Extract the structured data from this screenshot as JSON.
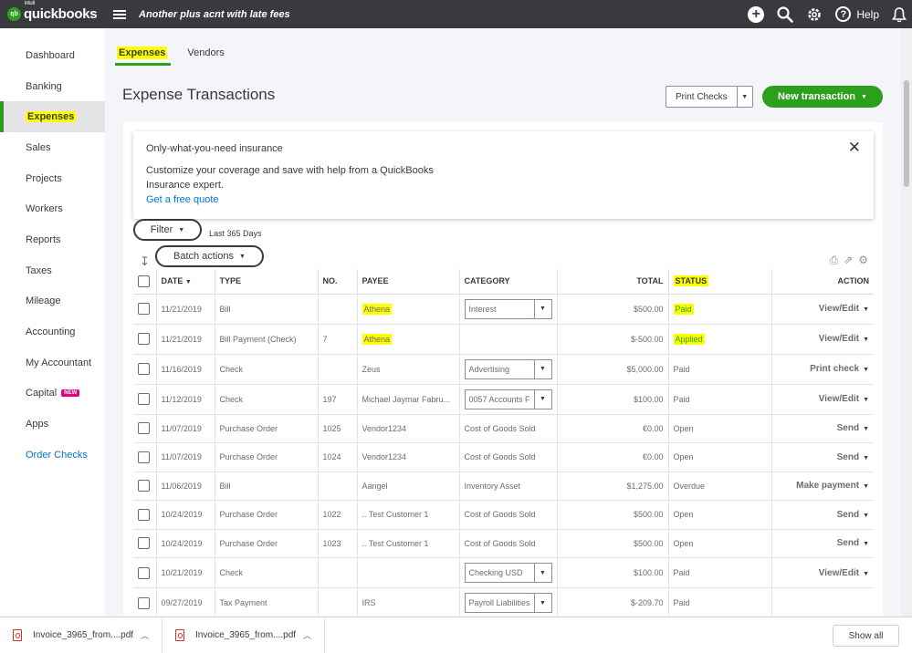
{
  "topbar": {
    "logo_intuit": "intuit",
    "logo_text": "quickbooks",
    "logo_badge": "qb",
    "company_name": "Another plus acnt with late fees",
    "help_label": "Help"
  },
  "sidebar": {
    "items": [
      {
        "label": "Dashboard"
      },
      {
        "label": "Banking"
      },
      {
        "label": "Expenses"
      },
      {
        "label": "Sales"
      },
      {
        "label": "Projects"
      },
      {
        "label": "Workers"
      },
      {
        "label": "Reports"
      },
      {
        "label": "Taxes"
      },
      {
        "label": "Mileage"
      },
      {
        "label": "Accounting"
      },
      {
        "label": "My Accountant"
      },
      {
        "label": "Capital",
        "badge": "NEW"
      },
      {
        "label": "Apps"
      },
      {
        "label": "Order Checks"
      }
    ]
  },
  "tabs": [
    {
      "label": "Expenses"
    },
    {
      "label": "Vendors"
    }
  ],
  "page_title": "Expense Transactions",
  "buttons": {
    "print_checks": "Print Checks",
    "new_transaction": "New transaction",
    "filter": "Filter",
    "filter_range": "Last 365 Days",
    "batch_actions": "Batch actions",
    "show_all": "Show all"
  },
  "insurance": {
    "title": "Only-what-you-need insurance",
    "body": "Customize your coverage and save with help from a QuickBooks Insurance expert.",
    "link": "Get a free quote"
  },
  "table": {
    "headers": {
      "date": "DATE",
      "type": "TYPE",
      "no": "NO.",
      "payee": "PAYEE",
      "category": "CATEGORY",
      "total": "TOTAL",
      "status": "STATUS",
      "action": "ACTION"
    },
    "rows": [
      {
        "date": "11/21/2019",
        "type": "Bill",
        "no": "",
        "payee": "Athena",
        "category": "Interest",
        "total": "$500.00",
        "status": "Paid",
        "action": "View/Edit"
      },
      {
        "date": "11/21/2019",
        "type": "Bill Payment (Check)",
        "no": "7",
        "payee": "Athena",
        "category": "",
        "total": "$-500.00",
        "status": "Applied",
        "action": "View/Edit"
      },
      {
        "date": "11/16/2019",
        "type": "Check",
        "no": "",
        "payee": "Zeus",
        "category": "Advertising",
        "total": "$5,000.00",
        "status": "Paid",
        "action": "Print check"
      },
      {
        "date": "11/12/2019",
        "type": "Check",
        "no": "197",
        "payee": "Michael Jaymar Fabru...",
        "category": "0057 Accounts F",
        "total": "$100.00",
        "status": "Paid",
        "action": "View/Edit"
      },
      {
        "date": "11/07/2019",
        "type": "Purchase Order",
        "no": "1025",
        "payee": "Vendor1234",
        "category": "Cost of Goods Sold",
        "total": "€0.00",
        "status": "Open",
        "action": "Send"
      },
      {
        "date": "11/07/2019",
        "type": "Purchase Order",
        "no": "1024",
        "payee": "Vendor1234",
        "category": "Cost of Goods Sold",
        "total": "€0.00",
        "status": "Open",
        "action": "Send"
      },
      {
        "date": "11/06/2019",
        "type": "Bill",
        "no": "",
        "payee": "Aangel",
        "category": "Inventory Asset",
        "total": "$1,275.00",
        "status": "Overdue",
        "action": "Make payment"
      },
      {
        "date": "10/24/2019",
        "type": "Purchase Order",
        "no": "1022",
        "payee": ".. Test Customer 1",
        "category": "Cost of Goods Sold",
        "total": "$500.00",
        "status": "Open",
        "action": "Send"
      },
      {
        "date": "10/24/2019",
        "type": "Purchase Order",
        "no": "1023",
        "payee": ".. Test Customer 1",
        "category": "Cost of Goods Sold",
        "total": "$500.00",
        "status": "Open",
        "action": "Send"
      },
      {
        "date": "10/21/2019",
        "type": "Check",
        "no": "",
        "payee": "",
        "category": "Checking USD",
        "total": "$100.00",
        "status": "Paid",
        "action": "View/Edit"
      },
      {
        "date": "09/27/2019",
        "type": "Tax Payment",
        "no": "",
        "payee": "IRS",
        "category": "Payroll Liabilities",
        "total": "$-209.70",
        "status": "Paid",
        "action": ""
      }
    ]
  },
  "downloads": [
    {
      "name": "Invoice_3965_from....pdf"
    },
    {
      "name": "Invoice_3965_from....pdf"
    }
  ],
  "colors": {
    "brand_green": "#2ca01c",
    "topbar": "#393a3d",
    "link_blue": "#0077c5",
    "overdue_orange": "#ff6a00",
    "highlight": "#ffff00"
  }
}
